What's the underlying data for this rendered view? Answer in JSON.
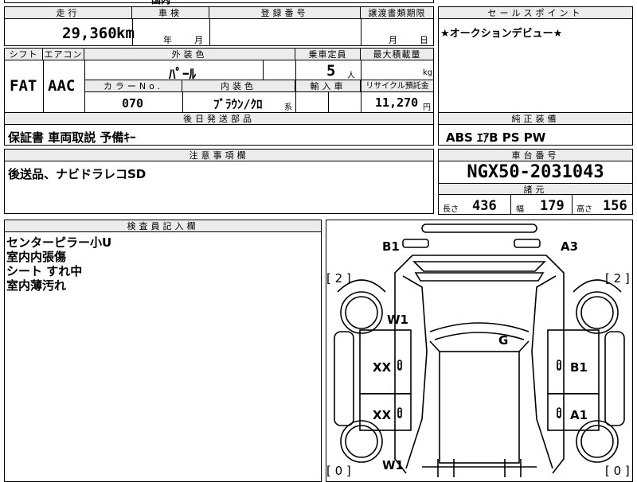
{
  "top_cut": {
    "left": "",
    "mid": "国内",
    "right": ""
  },
  "summary": {
    "mileage": {
      "header": "走行",
      "value": "29,360",
      "unit": "km"
    },
    "inspection": {
      "header": "車検",
      "year_unit": "年",
      "month_unit": "月"
    },
    "registration": {
      "header": "登録番号",
      "value": ""
    },
    "transfer_deadline": {
      "header": "譲渡書類期限",
      "month_unit": "月",
      "day_unit": "日"
    }
  },
  "sales_point": {
    "header": "セールスポイント",
    "text": "★オークションデビュー★"
  },
  "specs": {
    "shift": {
      "header": "シフト",
      "value": "FAT"
    },
    "aircon": {
      "header": "エアコン",
      "value": "AAC"
    },
    "exterior_color": {
      "header": "外装色",
      "value": "ﾊﾟｰﾙ"
    },
    "capacity": {
      "header": "乗車定員",
      "value": "5",
      "unit": "人"
    },
    "max_load": {
      "header": "最大積載量",
      "unit": "kg"
    },
    "color_no": {
      "header": "カラーNo.",
      "value": "070"
    },
    "interior_color": {
      "header": "内装色",
      "value": "ﾌﾞﾗｳﾝ/ｸﾛ",
      "unit": "系"
    },
    "import": {
      "header": "輸入車"
    },
    "recycle": {
      "header": "リサイクル預託金",
      "value": "11,270",
      "unit": "円"
    }
  },
  "later_parts": {
    "header": "後日発送部品",
    "text": "保証書 車両取説 予備ｷｰ"
  },
  "factory_equipment": {
    "header": "純正装備",
    "text": "ABS ｴｱB PS PW"
  },
  "notes": {
    "header": "注意事項欄",
    "text": "後送品、ナビドラレコSD"
  },
  "chassis": {
    "header": "車台番号",
    "value": "NGX50-2031043"
  },
  "dimensions": {
    "header": "諸元",
    "length_label": "長さ",
    "length": "436",
    "width_label": "幅",
    "width": "179",
    "height_label": "高さ",
    "height": "156"
  },
  "inspector": {
    "header": "検査員記入欄",
    "lines": [
      "センターピラー小U",
      "室内内張傷",
      "シート すれ中",
      "室内薄汚れ"
    ]
  },
  "diagram": {
    "marks": {
      "b1_top": "B1",
      "a3_top": "A3",
      "tire_fl": "[ 2 ]",
      "tire_fr": "[ 2 ]",
      "w1_left": "W1",
      "g_center": "G",
      "xx_upper": "XX",
      "b1_right": "B1",
      "xx_lower": "XX",
      "a1_right": "A1",
      "w1_bottom": "W1",
      "tire_rl": "[ 0 ]",
      "tire_rr": "[ 0 ]"
    },
    "door_mark": "0"
  }
}
